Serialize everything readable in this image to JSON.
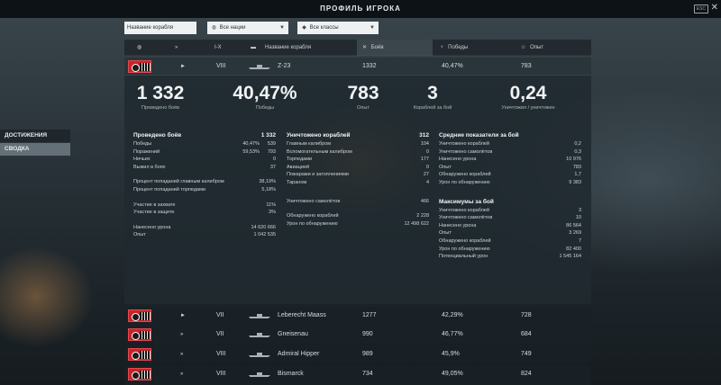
{
  "window": {
    "title": "ПРОФИЛЬ ИГРОКА",
    "esc_label": "ESC",
    "close_glyph": "✕"
  },
  "filters": {
    "ship_name_placeholder": "Название корабля",
    "nations_label": "Все нации",
    "classes_label": "Все классы"
  },
  "sidebar": {
    "achievements": "ДОСТИЖЕНИЯ",
    "summary": "СВОДКА"
  },
  "table_header": {
    "tier": "I-X",
    "ship_name": "Название корабля",
    "battles": "Боёв",
    "wins": "Победы",
    "experience": "Опыт"
  },
  "selected_ship": {
    "type_icon": "►",
    "tier": "VIII",
    "name": "Z-23",
    "battles": "1332",
    "wins": "40,47%",
    "experience": "783"
  },
  "summary": [
    {
      "value": "1 332",
      "label": "Проведено боёв"
    },
    {
      "value": "40,47%",
      "label": "Победы"
    },
    {
      "value": "783",
      "label": "Опыт"
    },
    {
      "value": "3",
      "label": "Кораблей за бой"
    },
    {
      "value": "0,24",
      "label": "Уничтожил / уничтожен"
    }
  ],
  "battles_section": {
    "title": "Проведено боёв",
    "value": "1 332",
    "group1": [
      {
        "label": "Победы",
        "percent": "40,47%",
        "value": "539"
      },
      {
        "label": "Поражений",
        "percent": "59,53%",
        "value": "793"
      },
      {
        "label": "Ничьих",
        "percent": "",
        "value": "0"
      },
      {
        "label": "Выжил в боях",
        "percent": "",
        "value": "37"
      }
    ],
    "group2": [
      {
        "label": "Процент попаданий главным калибром",
        "value": "38,19%"
      },
      {
        "label": "Процент попаданий торпедами",
        "value": "5,18%"
      }
    ],
    "group3": [
      {
        "label": "Участие в захвате",
        "value": "11%"
      },
      {
        "label": "Участие в защите",
        "value": "3%"
      }
    ],
    "group4": [
      {
        "label": "Нанесено урона",
        "value": "14 620 666"
      },
      {
        "label": "Опыт",
        "value": "1 042 535"
      }
    ]
  },
  "destroyed_section": {
    "title": "Уничтожено кораблей",
    "value": "312",
    "group1": [
      {
        "label": "Главным калибром",
        "value": "104"
      },
      {
        "label": "Вспомогательным калибром",
        "value": "0"
      },
      {
        "label": "Торпедами",
        "value": "177"
      },
      {
        "label": "Авиацией",
        "value": "0"
      },
      {
        "label": "Пожарами и затоплениями",
        "value": "27"
      },
      {
        "label": "Тараном",
        "value": "4"
      }
    ],
    "group2": [
      {
        "label": "Уничтожено самолётов",
        "value": "466"
      }
    ],
    "group3": [
      {
        "label": "Обнаружено кораблей",
        "value": "2 228"
      },
      {
        "label": "Урон по обнаружению",
        "value": "12 498 622"
      }
    ]
  },
  "average_section": {
    "title": "Средние показатели за бой",
    "items": [
      {
        "label": "Уничтожено кораблей",
        "value": "0,2"
      },
      {
        "label": "Уничтожено самолётов",
        "value": "0,3"
      },
      {
        "label": "Нанесено урона",
        "value": "10 976"
      },
      {
        "label": "Опыт",
        "value": "783"
      },
      {
        "label": "Обнаружено кораблей",
        "value": "1,7"
      },
      {
        "label": "Урон по обнаружению",
        "value": "9 383"
      }
    ]
  },
  "max_section": {
    "title": "Максимумы за бой",
    "items": [
      {
        "label": "Уничтожено кораблей",
        "value": "3"
      },
      {
        "label": "Уничтожено самолётов",
        "value": "10"
      },
      {
        "label": "Нанесено урона",
        "value": "86 564"
      },
      {
        "label": "Опыт",
        "value": "3 269"
      },
      {
        "label": "Обнаружено кораблей",
        "value": "7"
      },
      {
        "label": "Урон по обнаружению",
        "value": "82 400"
      },
      {
        "label": "Потенциальный урон",
        "value": "1 545 164"
      }
    ]
  },
  "other_ships": [
    {
      "type_icon": "►",
      "tier": "VII",
      "name": "Leberecht Maass",
      "battles": "1277",
      "wins": "42,29%",
      "experience": "728"
    },
    {
      "type_icon": "»",
      "tier": "VII",
      "name": "Gneisenau",
      "battles": "990",
      "wins": "46,77%",
      "experience": "684"
    },
    {
      "type_icon": "»",
      "tier": "VIII",
      "name": "Admiral Hipper",
      "battles": "989",
      "wins": "45,9%",
      "experience": "749"
    },
    {
      "type_icon": "»",
      "tier": "VIII",
      "name": "Bismarck",
      "battles": "734",
      "wins": "49,05%",
      "experience": "824"
    }
  ]
}
